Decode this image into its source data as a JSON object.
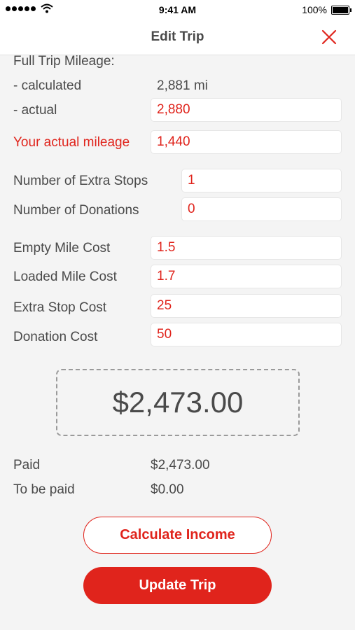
{
  "status_bar": {
    "time": "9:41 AM",
    "battery": "100%"
  },
  "header": {
    "title": "Edit Trip"
  },
  "mileage": {
    "section_label": "Full Trip Mileage:",
    "calculated_label": "- calculated",
    "calculated_value": "2,881 mi",
    "actual_label": "- actual",
    "actual_value": "2,880",
    "your_actual_label": "Your actual mileage",
    "your_actual_value": "1,440"
  },
  "counts": {
    "extra_stops_label": "Number of Extra Stops",
    "extra_stops_value": "1",
    "donations_label": "Number of Donations",
    "donations_value": "0"
  },
  "costs": {
    "empty_mile_label": "Empty Mile Cost",
    "empty_mile_value": "1.5",
    "loaded_mile_label": "Loaded Mile Cost",
    "loaded_mile_value": "1.7",
    "extra_stop_label": "Extra Stop Cost",
    "extra_stop_value": "25",
    "donation_label": "Donation Cost",
    "donation_value": "50"
  },
  "total": "$2,473.00",
  "payment": {
    "paid_label": "Paid",
    "paid_value": "$2,473.00",
    "to_be_paid_label": "To be paid",
    "to_be_paid_value": "$0.00"
  },
  "buttons": {
    "calculate": "Calculate Income",
    "update": "Update Trip"
  },
  "colors": {
    "accent": "#e0241c",
    "text": "#4a4a4a",
    "background": "#f4f4f4"
  },
  "icons": {
    "close": "close-icon",
    "wifi": "wifi-icon",
    "battery": "battery-icon"
  }
}
